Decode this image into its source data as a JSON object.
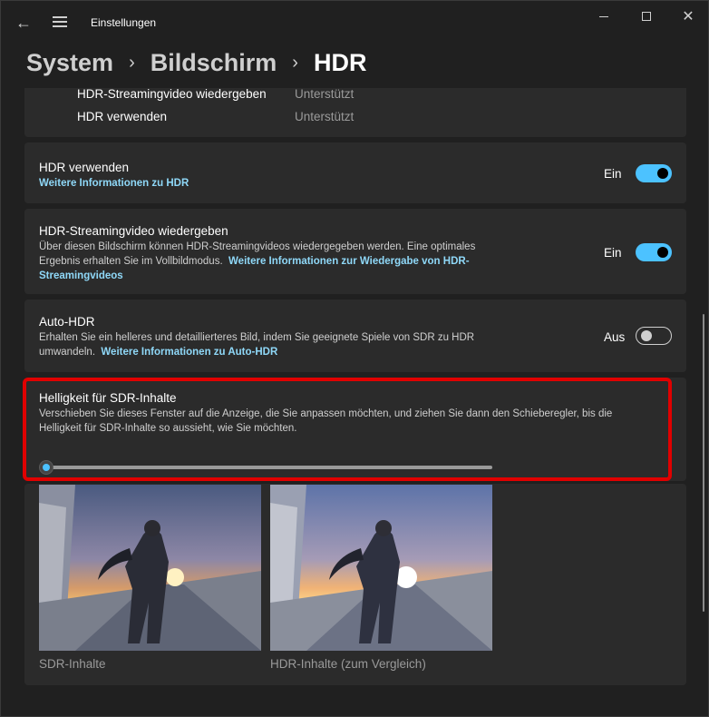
{
  "window": {
    "app_title": "Einstellungen",
    "back_icon": "back-arrow-icon",
    "menu_icon": "hamburger-menu-icon"
  },
  "breadcrumb": {
    "items": [
      "System",
      "Bildschirm",
      "HDR"
    ],
    "separator": "›"
  },
  "capabilities": {
    "rows": [
      {
        "label": "HDR-Streamingvideo wiedergeben",
        "value": "Unterstützt"
      },
      {
        "label": "HDR verwenden",
        "value": "Unterstützt"
      }
    ]
  },
  "settings": {
    "hdr": {
      "title": "HDR verwenden",
      "link": "Weitere Informationen zu HDR",
      "state": "Ein",
      "on": true
    },
    "streaming": {
      "title": "HDR-Streamingvideo wiedergeben",
      "desc_line1": "Über diesen Bildschirm können HDR-Streamingvideos wiedergegeben werden. Eine optimales",
      "desc_line2": "Ergebnis erhalten Sie im Vollbildmodus.",
      "link_part1": "Weitere Informationen zur Wiedergabe von HDR-",
      "link_part2": "Streamingvideos",
      "state": "Ein",
      "on": true
    },
    "auto_hdr": {
      "title": "Auto-HDR",
      "desc_line1": "Erhalten Sie ein helleres und detaillierteres Bild, indem Sie geeignete Spiele von SDR zu HDR",
      "desc_line2": "umwandeln.",
      "link": "Weitere Informationen zu Auto-HDR",
      "state": "Aus",
      "on": false
    },
    "sdr_brightness": {
      "title": "Helligkeit für SDR-Inhalte",
      "desc_line1": "Verschieben Sie dieses Fenster auf die Anzeige, die Sie anpassen möchten, und ziehen Sie dann den Schieberegler, bis die",
      "desc_line2": "Helligkeit für SDR-Inhalte so aussieht, wie Sie möchten.",
      "slider_value": 0
    }
  },
  "preview": {
    "sdr_caption": "SDR-Inhalte",
    "hdr_caption": "HDR-Inhalte (zum Vergleich)"
  },
  "colors": {
    "accent": "#4cc2ff",
    "link": "#8fd8f8",
    "highlight": "#e00000",
    "background": "#202020",
    "card": "#2b2b2b"
  }
}
